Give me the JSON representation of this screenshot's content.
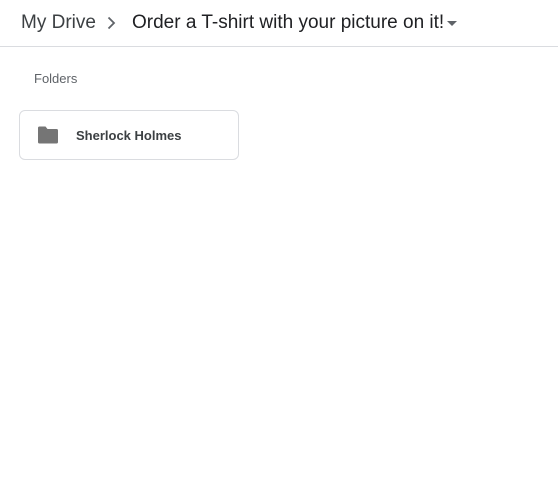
{
  "breadcrumb": {
    "root_label": "My Drive",
    "separator_icon": "chevron-right-icon",
    "current_label": "Order a T-shirt with your picture on it!",
    "dropdown_icon": "caret-down-icon"
  },
  "folders_section": {
    "label": "Folders",
    "items": [
      {
        "name": "Sherlock Holmes",
        "icon": "folder-icon"
      }
    ]
  },
  "colors": {
    "text_primary": "#202124",
    "text_secondary": "#5f6368",
    "icon_gray": "#757575",
    "border": "#dadce0"
  }
}
